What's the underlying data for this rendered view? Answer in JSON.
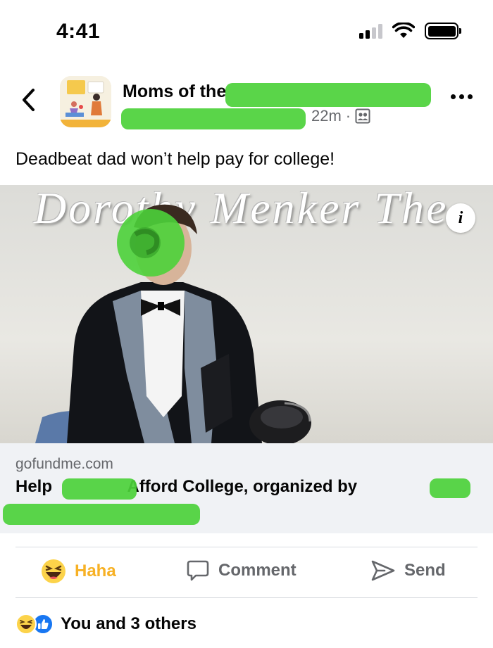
{
  "status_bar": {
    "time": "4:41",
    "icons": [
      "cellular-signal-icon",
      "wifi-icon",
      "battery-icon"
    ]
  },
  "post": {
    "group_name": "Moms of the",
    "timestamp": "22m",
    "separator": "·",
    "privacy_icon": "group-members-icon",
    "text": "Deadbeat dad won’t help pay for college!",
    "image": {
      "wall_text": "Dorothy Menker The",
      "info_label": "i"
    },
    "link": {
      "domain": "gofundme.com",
      "title_part1": "Help",
      "title_part2": "Afford College, organized by"
    }
  },
  "actions": {
    "haha": "Haha",
    "comment": "Comment",
    "send": "Send"
  },
  "reactions": {
    "icons": [
      "haha-reaction-icon",
      "like-reaction-icon"
    ],
    "summary": "You and 3 others"
  },
  "colors": {
    "text": "#050505",
    "secondary": "#65676b",
    "haha_yellow": "#f7b125",
    "like_blue": "#1877f2",
    "redaction_green": "#4cd13a",
    "link_bg": "#f0f2f5"
  }
}
